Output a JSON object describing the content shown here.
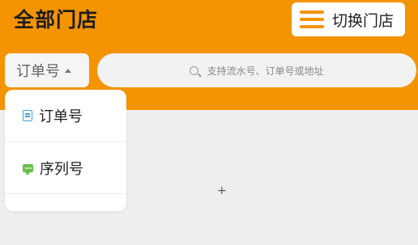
{
  "header": {
    "title": "全部门店",
    "switch_store_label": "切换门店"
  },
  "filter": {
    "selected_type": "订单号",
    "search_placeholder": "支持流水号、订单号或地址"
  },
  "dropdown": {
    "items": [
      {
        "label": "订单号",
        "icon": "document-icon"
      },
      {
        "label": "序列号",
        "icon": "chat-bubble-icon"
      },
      {
        "label": ""
      }
    ]
  },
  "content": {
    "marker": "+"
  },
  "colors": {
    "brand": "#f39400",
    "doc_icon": "#36a8d0",
    "chat_icon": "#6cc04a"
  }
}
